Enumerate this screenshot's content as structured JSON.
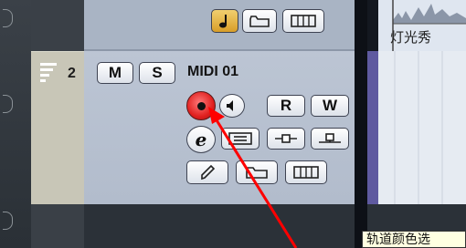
{
  "track": {
    "number": "2",
    "name": "MIDI 01"
  },
  "buttons": {
    "mute": "M",
    "solo": "S",
    "read": "R",
    "write": "W"
  },
  "clip_label": "灯光秀",
  "tooltip": "轨道颜色选",
  "colors": {
    "record": "#e0201f",
    "track_color": "#c8c6b7",
    "panel": "#b8c2d2",
    "annotation_arrow": "#ff0000"
  },
  "icons": [
    "midi-track-icon",
    "record-icon",
    "monitor-speaker-icon",
    "edit-e-icon",
    "lanes-icon",
    "insert-icon",
    "eq-icon",
    "draw-pencil-icon",
    "folder-icon",
    "keyboard-icon",
    "note-icon"
  ]
}
